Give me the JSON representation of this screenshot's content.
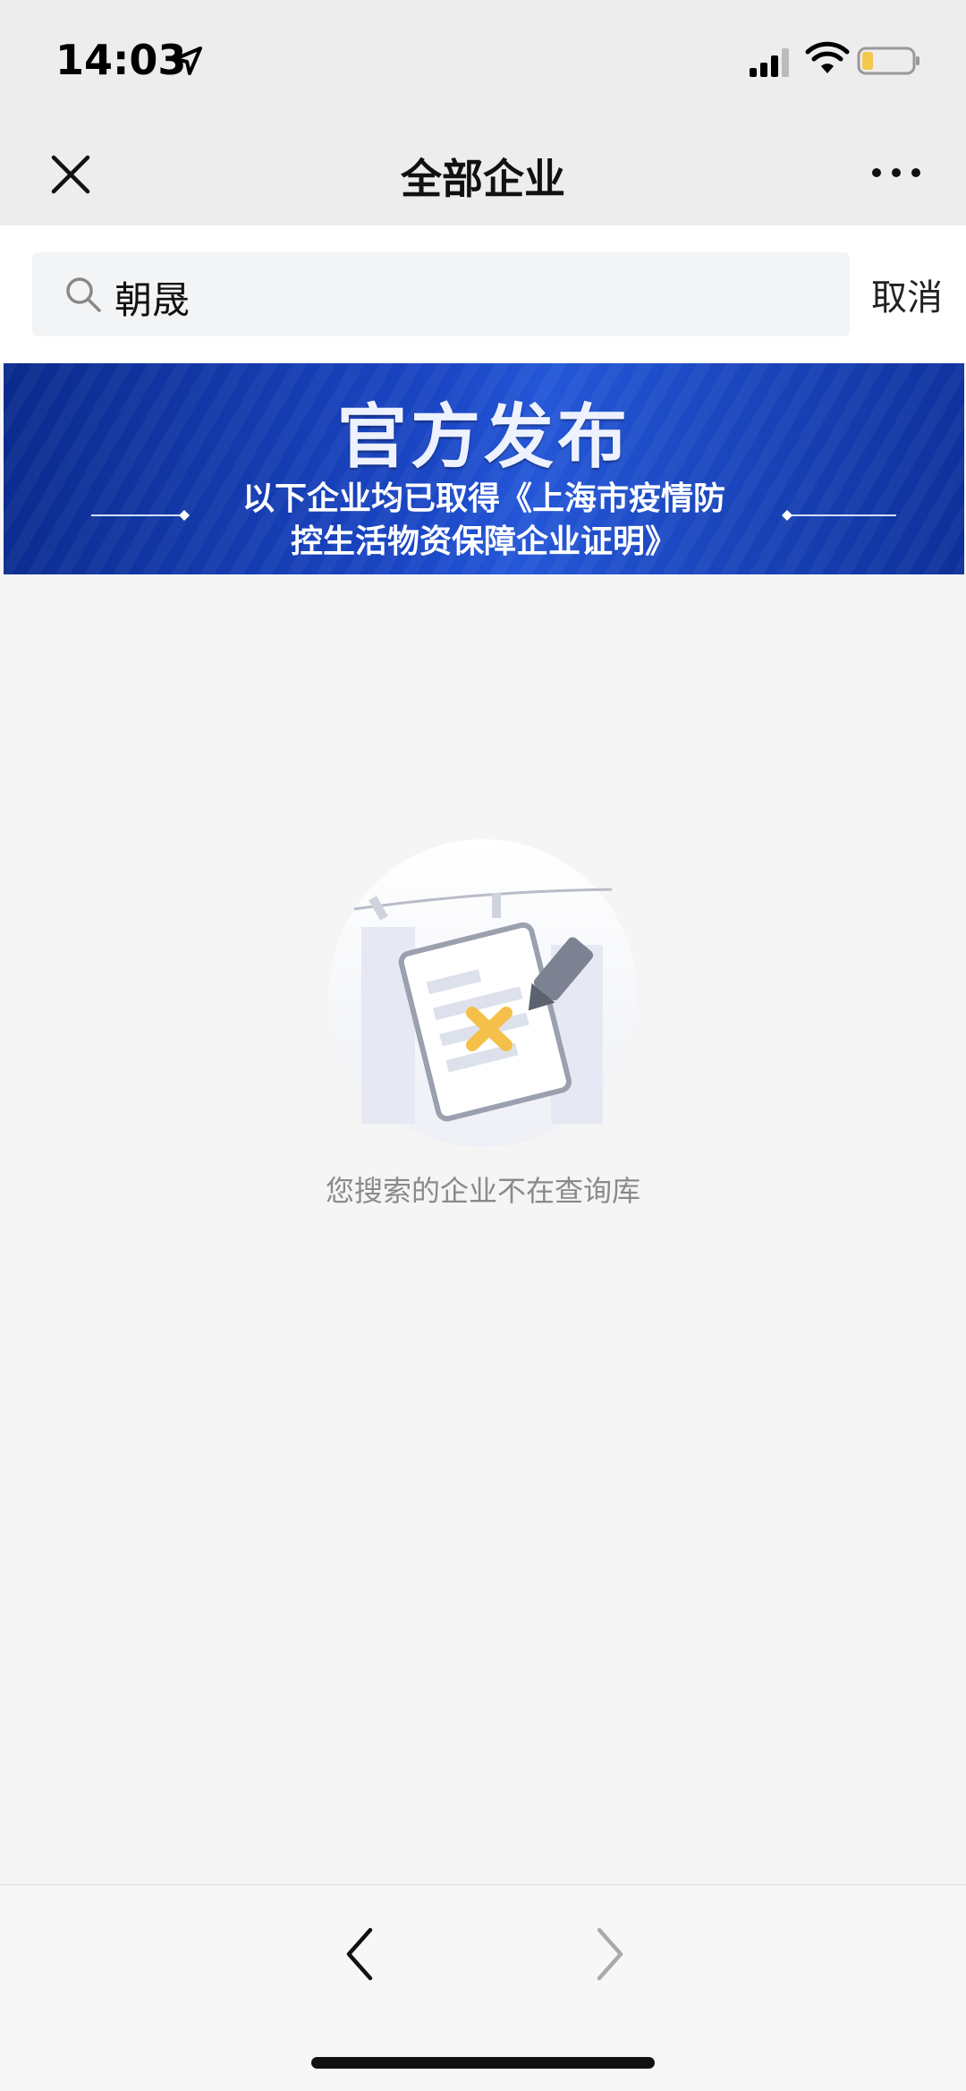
{
  "status_bar": {
    "time": "14:03",
    "icons": [
      "location-arrow-icon",
      "signal-icon",
      "wifi-icon",
      "battery-icon"
    ],
    "battery_color": "#f2c94c"
  },
  "nav": {
    "title": "全部企业",
    "close_icon": "close-icon",
    "more_icon": "more-dots-icon"
  },
  "search": {
    "query": "朝晟",
    "cancel_label": "取消",
    "icon": "search-icon"
  },
  "banner": {
    "title": "官方发布",
    "line1": "以下企业均已取得《上海市疫情防",
    "line2": "控生活物资保障企业证明》",
    "colors": {
      "dark": "#0a2a8c",
      "light": "#2457d8"
    }
  },
  "empty_state": {
    "illustration": "document-x-icon",
    "message": "您搜索的企业不在查询库",
    "accent": "#f5c04a"
  },
  "bottom_toolbar": {
    "back_icon": "chevron-left-icon",
    "forward_icon": "chevron-right-icon"
  }
}
